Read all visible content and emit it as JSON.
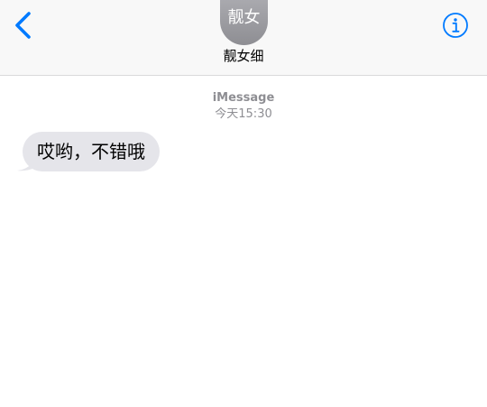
{
  "header": {
    "back_icon": "chevron-left-icon",
    "avatar_text": "靓女",
    "contact_name": "靓女细",
    "info_icon": "info-circle-icon"
  },
  "conversation": {
    "service": "iMessage",
    "timestamp": "今天15:30",
    "messages": [
      {
        "direction": "incoming",
        "text": "哎哟，不错哦"
      }
    ]
  },
  "colors": {
    "accent": "#007aff",
    "header_bg": "#f8f8f8",
    "incoming_bubble": "#e5e5ea",
    "meta_text": "#8e8e93",
    "avatar_bg": "#9a9a9f"
  }
}
